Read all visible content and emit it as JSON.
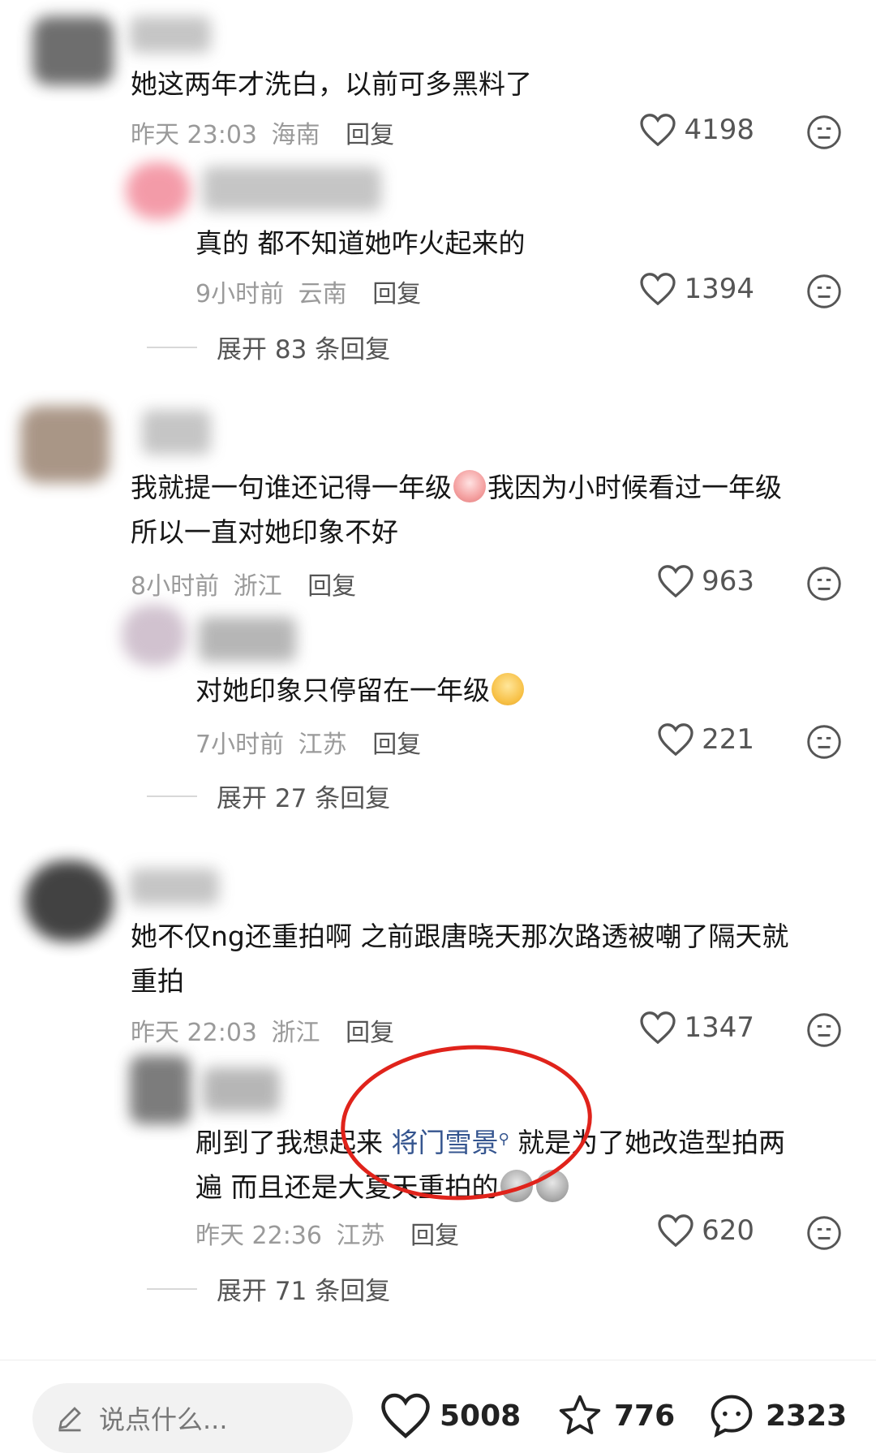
{
  "comments": [
    {
      "text": "她这两年才洗白，以前可多黑料了",
      "time": "昨天 23:03",
      "location": "海南",
      "reply_label": "回复",
      "likes": "4198"
    },
    {
      "text": "真的 都不知道她咋火起来的",
      "time": "9小时前",
      "location": "云南",
      "reply_label": "回复",
      "likes": "1394"
    },
    {
      "text_part1": "我就提一句谁还记得一年级",
      "text_part2": "我因为小时候看过一年级",
      "text_line2": "所以一直对她印象不好",
      "time": "8小时前",
      "location": "浙江",
      "reply_label": "回复",
      "likes": "963"
    },
    {
      "text": "对她印象只停留在一年级",
      "time": "7小时前",
      "location": "江苏",
      "reply_label": "回复",
      "likes": "221"
    },
    {
      "text_line1": "她不仅ng还重拍啊 之前跟唐晓天那次路透被嘲了隔天就",
      "text_line2": "重拍",
      "time": "昨天 22:03",
      "location": "浙江",
      "reply_label": "回复",
      "likes": "1347"
    },
    {
      "text_pre": "刷到了我想起来 ",
      "link": "将门雪景",
      "text_post": " 就是为了她改造型拍两",
      "text_line2": "遍 而且还是大夏天重拍的",
      "time": "昨天 22:36",
      "location": "江苏",
      "reply_label": "回复",
      "likes": "620"
    }
  ],
  "expand": [
    "展开 83 条回复",
    "展开 27 条回复",
    "展开 71 条回复"
  ],
  "bottom_bar": {
    "placeholder": "说点什么...",
    "likes": "5008",
    "stars": "776",
    "comments": "2323"
  },
  "colors": {
    "link": "#35558f",
    "annotation": "#e0231b"
  }
}
